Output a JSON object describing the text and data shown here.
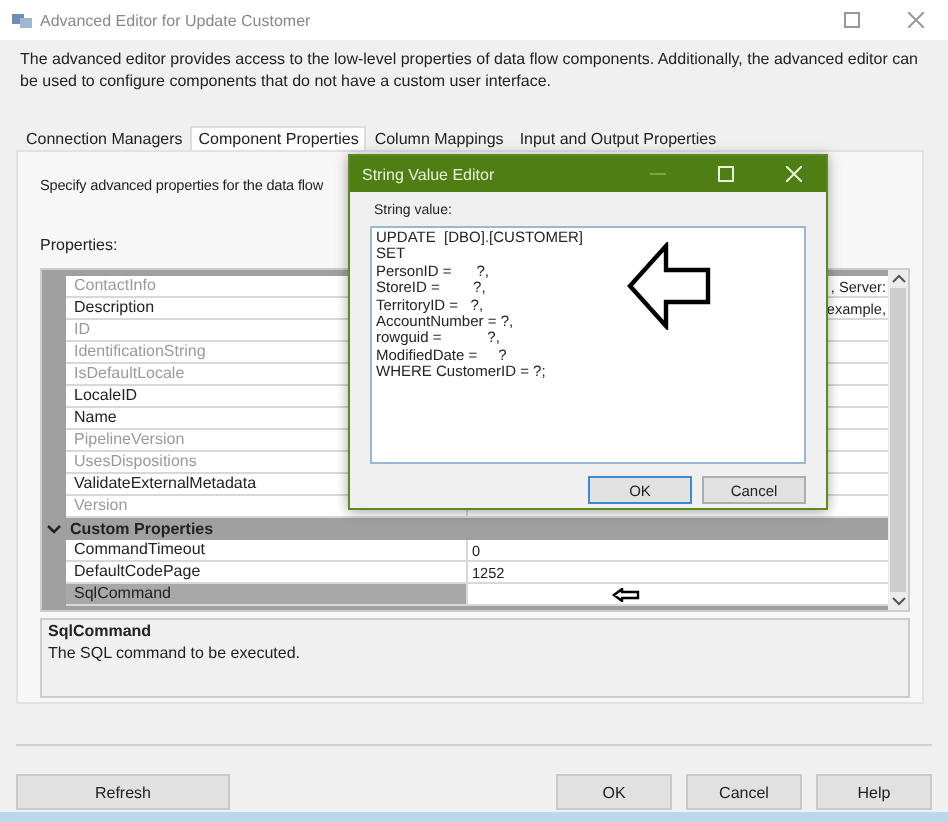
{
  "window": {
    "title": "Advanced Editor for Update Customer"
  },
  "description": "The advanced editor provides access to the low-level properties of data flow components. Additionally, the advanced editor can be used to configure components that do not have a custom user interface.",
  "tabs": [
    {
      "label": "Connection Managers",
      "selected": false
    },
    {
      "label": "Component Properties",
      "selected": true
    },
    {
      "label": "Column Mappings",
      "selected": false
    },
    {
      "label": "Input and Output Properties",
      "selected": false
    }
  ],
  "panel": {
    "intro": "Specify advanced properties for the data flow",
    "properties_label": "Properties:"
  },
  "property_groups": [
    {
      "rows": [
        {
          "name": "ContactInfo",
          "value": ", Server:",
          "disabled": true,
          "selected": false
        },
        {
          "name": "Description",
          "value": "example,",
          "disabled": false,
          "selected": false
        },
        {
          "name": "ID",
          "disabled": true,
          "selected": false
        },
        {
          "name": "IdentificationString",
          "disabled": true,
          "selected": false
        },
        {
          "name": "IsDefaultLocale",
          "disabled": true,
          "selected": false
        },
        {
          "name": "LocaleID",
          "disabled": false,
          "selected": false
        },
        {
          "name": "Name",
          "disabled": false,
          "selected": false
        },
        {
          "name": "PipelineVersion",
          "disabled": true,
          "selected": false
        },
        {
          "name": "UsesDispositions",
          "disabled": true,
          "selected": false
        },
        {
          "name": "ValidateExternalMetadata",
          "disabled": false,
          "selected": false
        },
        {
          "name": "Version",
          "disabled": true,
          "selected": false
        }
      ]
    },
    {
      "name": "Custom Properties",
      "expanded": true,
      "rows": [
        {
          "name": "CommandTimeout",
          "value": "0",
          "disabled": false,
          "selected": false
        },
        {
          "name": "DefaultCodePage",
          "value": "1252",
          "disabled": false,
          "selected": false
        },
        {
          "name": "SqlCommand",
          "value": "",
          "disabled": false,
          "selected": true,
          "annotated": true
        }
      ]
    }
  ],
  "help": {
    "title": "SqlCommand",
    "text": "The SQL command to be executed."
  },
  "buttons": [
    {
      "label": "Refresh",
      "kind": "left"
    },
    {
      "label": "OK",
      "kind": "right"
    },
    {
      "label": "Cancel",
      "kind": "right"
    },
    {
      "label": "Help",
      "kind": "right"
    }
  ],
  "dialog": {
    "title": "String Value Editor",
    "field_label": "String value:",
    "value": "UPDATE  [DBO].[CUSTOMER]\nSET\nPersonID =      ?,\nStoreID =        ?,\nTerritoryID =   ?,\nAccountNumber = ?,\nrowguid =           ?,\nModifiedDate =     ?\nWHERE CustomerID = ?;",
    "buttons": [
      {
        "label": "OK",
        "default": true
      },
      {
        "label": "Cancel",
        "default": false
      }
    ]
  }
}
